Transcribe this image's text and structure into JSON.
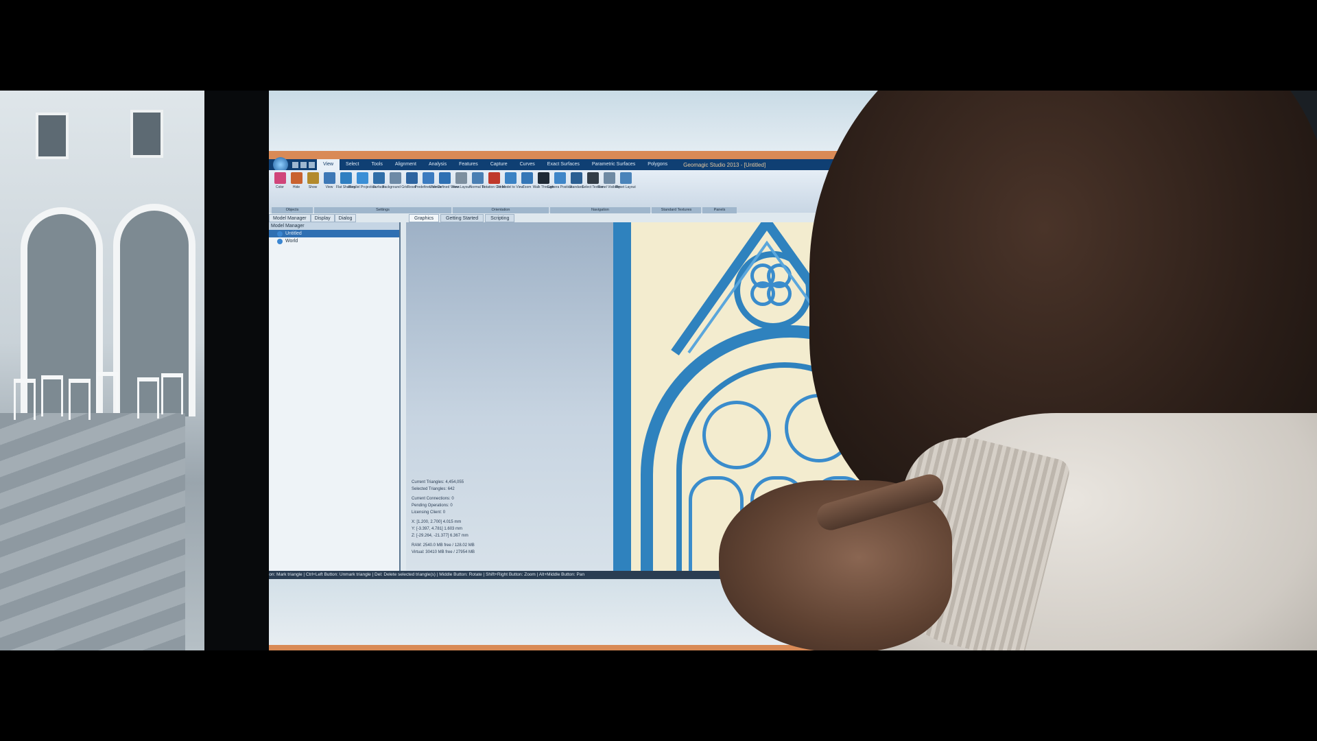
{
  "app": {
    "title": "Geomagic Studio 2013 - [Untitled]"
  },
  "ribbon_tabs": [
    "View",
    "Select",
    "Tools",
    "Alignment",
    "Analysis",
    "Features",
    "Capture",
    "Curves",
    "Exact Surfaces",
    "Parametric Surfaces",
    "Polygons"
  ],
  "active_tab": "View",
  "ribbon_buttons": [
    {
      "label": "Color",
      "color": "#d0457a"
    },
    {
      "label": "Hide",
      "color": "#c9622f"
    },
    {
      "label": "Show",
      "color": "#b38a2c"
    },
    {
      "label": "View",
      "color": "#3d78b6"
    },
    {
      "label": "Flat Shading",
      "color": "#2f7fc1"
    },
    {
      "label": "Parallel Projection",
      "color": "#3a8fd6"
    },
    {
      "label": "Surface",
      "color": "#2f6ea8"
    },
    {
      "label": "Background Grid",
      "color": "#6d8aa6"
    },
    {
      "label": "Reset",
      "color": "#2d64a0"
    },
    {
      "label": "Predefined Views",
      "color": "#3b7bc0"
    },
    {
      "label": "User Defined Views",
      "color": "#2e70b3"
    },
    {
      "label": "View Layout",
      "color": "#7d8f9f"
    },
    {
      "label": "Normal To",
      "color": "#4a7fb3"
    },
    {
      "label": "Rotation Center",
      "color": "#c0392b"
    },
    {
      "label": "Fit Model to View",
      "color": "#3a82c4"
    },
    {
      "label": "Zoom",
      "color": "#3577b7"
    },
    {
      "label": "Walk Through",
      "color": "#1f2a36"
    },
    {
      "label": "Camera Position",
      "color": "#3f86c8"
    },
    {
      "label": "Standard",
      "color": "#2b5f92"
    },
    {
      "label": "Select Texture",
      "color": "#333d47"
    },
    {
      "label": "Panel Visibility",
      "color": "#6f8aa3"
    },
    {
      "label": "Reset Layout",
      "color": "#4b84ba"
    }
  ],
  "ribbon_groups": [
    "Objects",
    "Settings",
    "Orientation",
    "Navigation",
    "Standard Textures",
    "Panels"
  ],
  "panel_tabs": [
    "Model Manager",
    "Display",
    "Dialog"
  ],
  "model_manager": {
    "title": "Model Manager",
    "items": [
      {
        "label": "Untitled",
        "selected": true
      },
      {
        "label": "World",
        "selected": false
      }
    ]
  },
  "doc_tabs": [
    "Graphics",
    "Getting Started",
    "Scripting"
  ],
  "active_doc_tab": "Graphics",
  "stats": [
    "Current Triangles: 4,454,055",
    "Selected Triangles: 642",
    "Current Connections: 0",
    "Pending Operations: 0",
    "Licensing Client: 0",
    "X: [1.200, 2.700] 4.015 mm",
    "Y: [-3.397, 4.781] 1.603 mm",
    "Z: [-29.264, -21.377] 6.367 mm",
    "RAM: 2540.0 MB free / 128.02 MB",
    "Virtual: 30410 MB free / 27954 MB"
  ],
  "status_bar": "Left Button: Mark triangle | Ctrl+Left Button: Unmark triangle | Del: Delete selected triangle(s) | Middle Button: Rotate | Shift+Right Button: Zoom | Alt+Middle Button: Pan",
  "colors": {
    "ribbon_bg": "#0f3f73",
    "model_blue": "#2f82be",
    "model_cream": "#f3eccf",
    "accent_orange": "#d98a56"
  }
}
